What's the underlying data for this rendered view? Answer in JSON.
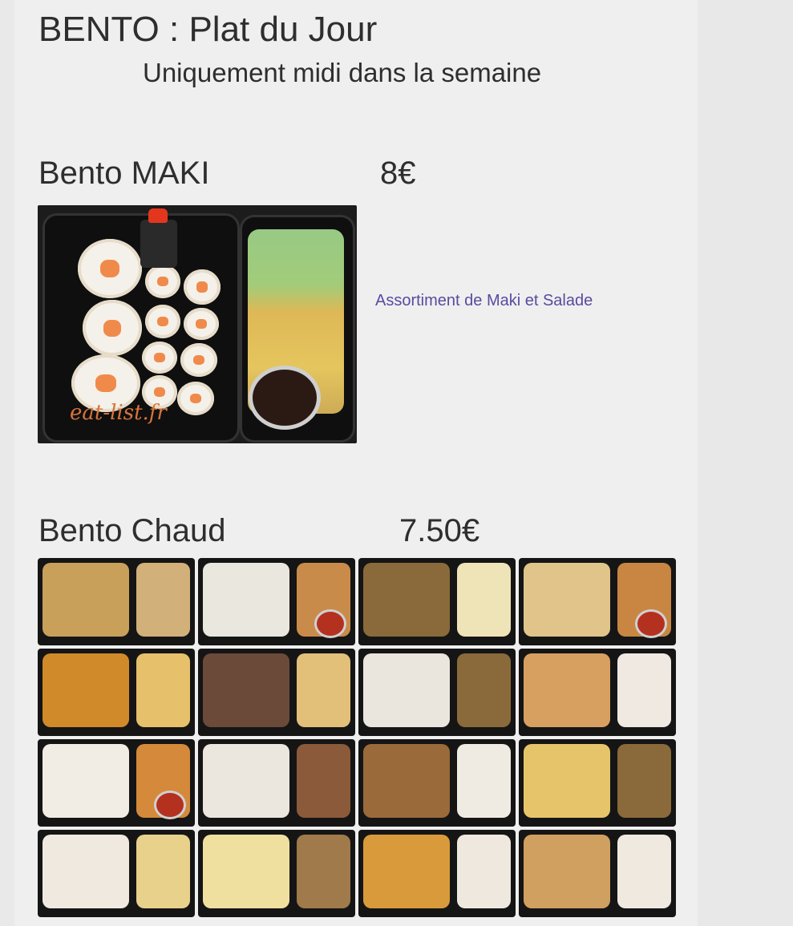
{
  "header": {
    "title": "BENTO : Plat du Jour",
    "subtitle": "Uniquement midi dans la semaine"
  },
  "items": [
    {
      "name": "Bento MAKI",
      "price": "8€",
      "description": "Assortiment de Maki et Salade",
      "image_watermark": "eat-list.fr"
    },
    {
      "name": "Bento Chaud",
      "price": "7.50€"
    }
  ],
  "colors": {
    "page_bg": "#efefef",
    "text": "#2e2e2e",
    "link": "#5b4aa0",
    "watermark": "#d7743b"
  },
  "gallery_tiles": [
    {
      "left": "#c9a05a",
      "right": "#d2b07a",
      "cup": false
    },
    {
      "left": "#eae7df",
      "right": "#c98b4a",
      "cup": true
    },
    {
      "left": "#8a6a3a",
      "right": "#efe4b8",
      "cup": false
    },
    {
      "left": "#e0c48a",
      "right": "#c88642",
      "cup": true
    },
    {
      "left": "#d08a2a",
      "right": "#e6c06a",
      "cup": false
    },
    {
      "left": "#6b4a3a",
      "right": "#e2c07a",
      "cup": false
    },
    {
      "left": "#eae6de",
      "right": "#8a6a3a",
      "cup": false
    },
    {
      "left": "#d8a060",
      "right": "#efe9e1",
      "cup": false
    },
    {
      "left": "#f1ede4",
      "right": "#d48a3a",
      "cup": true
    },
    {
      "left": "#ebe7de",
      "right": "#8a5a3a",
      "cup": false
    },
    {
      "left": "#9a6a3a",
      "right": "#f0ebe2",
      "cup": false
    },
    {
      "left": "#e6c56a",
      "right": "#8a6a3a",
      "cup": false
    },
    {
      "left": "#efe9df",
      "right": "#e8d18a",
      "cup": false
    },
    {
      "left": "#f0e0a0",
      "right": "#a07a4a",
      "cup": false
    },
    {
      "left": "#d89a3a",
      "right": "#efe8de",
      "cup": false
    },
    {
      "left": "#d0a060",
      "right": "#efe9e0",
      "cup": false
    }
  ]
}
